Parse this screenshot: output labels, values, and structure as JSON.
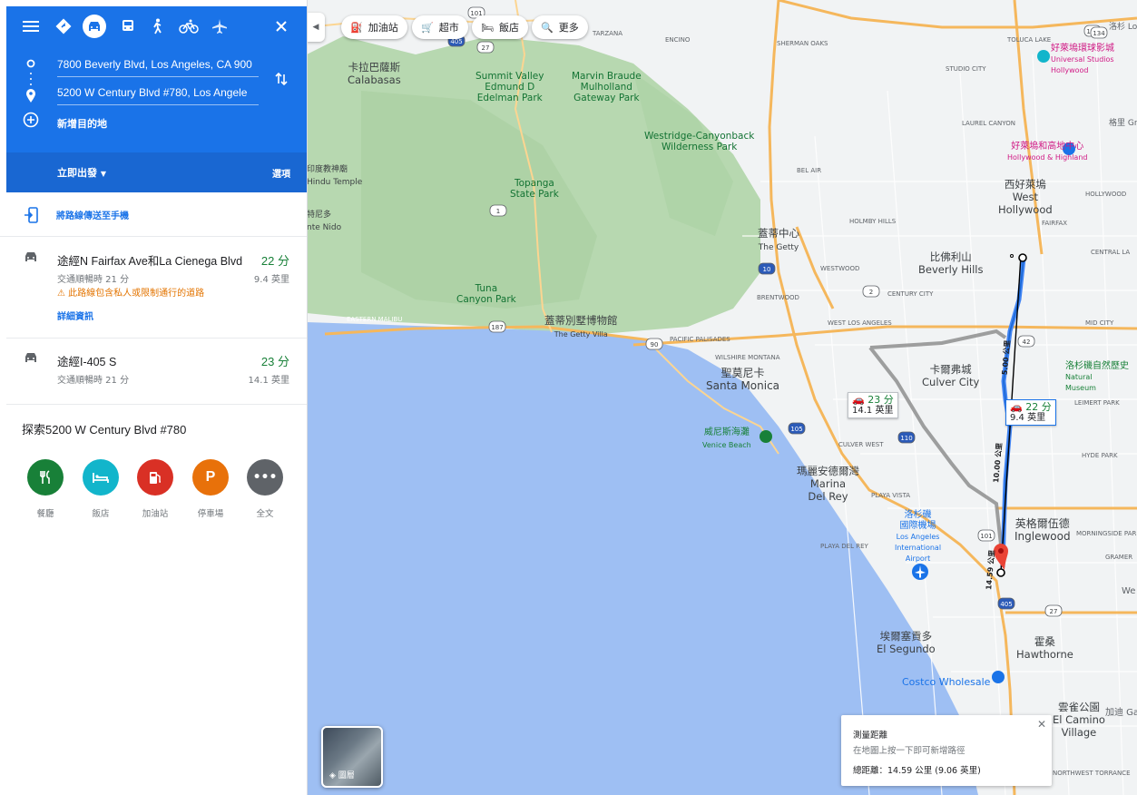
{
  "directions": {
    "modes": [
      "menu",
      "best",
      "driving",
      "transit",
      "walking",
      "cycling",
      "flight"
    ],
    "origin": "7800 Beverly Blvd, Los Angeles, CA 900",
    "destination": "5200 W Century Blvd #780, Los Angele",
    "add_destination": "新增目的地",
    "leave_now": "立即出發",
    "options": "選項",
    "send_to_phone": "將路線傳送至手機"
  },
  "routes": [
    {
      "title": "途經N Fairfax Ave和La Cienega Blvd",
      "time": "22 分",
      "traffic": "交通順暢時 21 分",
      "distance": "9.4 英里",
      "warning": "此路線包含私人或限制通行的道路",
      "details": "詳細資訊"
    },
    {
      "title": "途經I-405 S",
      "time": "23 分",
      "traffic": "交通順暢時 21 分",
      "distance": "14.1 英里"
    }
  ],
  "explore": {
    "title": "探索5200 W Century Blvd #780",
    "items": [
      {
        "label": "餐廳",
        "icon": "restaurant-icon",
        "color": "#188038"
      },
      {
        "label": "飯店",
        "icon": "hotel-icon",
        "color": "#12b5cb"
      },
      {
        "label": "加油站",
        "icon": "gas-station-icon",
        "color": "#d93025"
      },
      {
        "label": "停車場",
        "icon": "parking-icon",
        "color": "#e8710a"
      },
      {
        "label": "全文",
        "icon": "more-icon",
        "color": "#5f6368"
      }
    ]
  },
  "map": {
    "chips": [
      "加油站",
      "超市",
      "飯店",
      "更多"
    ],
    "labels": {
      "calabasas_zh": "卡拉巴薩斯",
      "calabasas": "Calabasas",
      "summit_valley": "Summit Valley",
      "edmund": "Edmund D",
      "edelman": "Edelman Park",
      "marvin": "Marvin Braude",
      "mulholland": "Mulholland",
      "gateway": "Gateway Park",
      "westridge": "Westridge-Canyonback",
      "wilderness": "Wilderness Park",
      "topanga": "Topanga",
      "state_park": "State Park",
      "tuna": "Tuna",
      "canyon_park": "Canyon Park",
      "getty_zh": "蓋蒂中心",
      "getty": "The Getty",
      "villa_zh": "蓋蒂別墅博物館",
      "villa": "The Getty Villa",
      "sm_zh": "聖莫尼卡",
      "sm": "Santa Monica",
      "venice_zh": "威尼斯海灘",
      "venice": "Venice Beach",
      "marina_zh": "瑪麗安德爾灣",
      "marina1": "Marina",
      "marina2": "Del Rey",
      "culver_zh": "卡爾弗城",
      "culver": "Culver City",
      "bh_zh": "比佛利山",
      "bh": "Beverly Hills",
      "wh_zh": "西好萊塢",
      "wh1": "West",
      "wh2": "Hollywood",
      "hh_zh": "好萊塢和高地中心",
      "hh": "Hollywood & Highland",
      "us_zh": "好萊塢環球影城",
      "us1": "Universal Studios",
      "us2": "Hollywood",
      "nhm_zh": "洛杉磯自然歷史",
      "nhm1": "Natural",
      "nhm2": "Museum",
      "lax_zh1": "洛杉磯",
      "lax_zh2": "國際機場",
      "lax1": "Los Angeles",
      "lax2": "International",
      "lax3": "Airport",
      "ing_zh": "英格爾伍德",
      "ing": "Inglewood",
      "els_zh": "埃爾塞貢多",
      "els": "El Segundo",
      "haw_zh": "霍桑",
      "haw": "Hawthorne",
      "costco": "Costco Wholesale",
      "ec_zh": "雲雀公園",
      "ec1": "El Camino",
      "ec2": "Village",
      "india_zh": "印度教神廟",
      "india": "Hindu Temple",
      "nido_zh": "特尼多",
      "nido": "nte Nido",
      "tarzana": "TARZANA",
      "encino": "ENCINO",
      "sherman": "SHERMAN OAKS",
      "studio": "STUDIO CITY",
      "toluca": "TOLUCA LAKE",
      "laurel": "LAUREL CANYON",
      "belair": "BEL AIR",
      "holmby": "HOLMBY HILLS",
      "westwood": "WESTWOOD",
      "brentwood": "BRENTWOOD",
      "century": "CENTURY CITY",
      "westla": "WEST LOS ANGELES",
      "palisades": "PACIFIC PALISADES",
      "wilshire": "WILSHIRE MONTANA",
      "malibu": "EASTERN MALIBU",
      "playa": "PLAYA VISTA",
      "playadr": "PLAYA DEL REY",
      "culverwest": "CULVER WEST",
      "fairfax": "FAIRFAX",
      "central": "CENTRAL LA",
      "midcity": "MID CITY",
      "leimert": "LEIMERT PARK",
      "hydepark": "HYDE PARK",
      "morning": "MORNINGSIDE PARK",
      "gramer": "GRAMER",
      "northwest": "NORTHWEST TORRANCE",
      "hollywood": "HOLLYWOOD",
      "griffith": "格里 Griffi",
      "la_top": "洛杉 Los",
      "gard": "加迪 Gard",
      "we": "We"
    },
    "route_labels": [
      {
        "time": "23 分",
        "dist": "14.1 英里"
      },
      {
        "time": "22 分",
        "dist": "9.4 英里"
      }
    ],
    "measure_segments": [
      "5.00 公里",
      "10.00 公里",
      "14.59 公里"
    ],
    "measure": {
      "title": "測量距離",
      "hint": "在地圖上按一下即可新增路徑",
      "total": "總距離：14.59 公里 (9.06 英里)"
    },
    "layers_label": "圖層",
    "shields": [
      "101",
      "405",
      "27",
      "134",
      "1",
      "10",
      "2",
      "187",
      "90",
      "42",
      "105",
      "110"
    ]
  }
}
